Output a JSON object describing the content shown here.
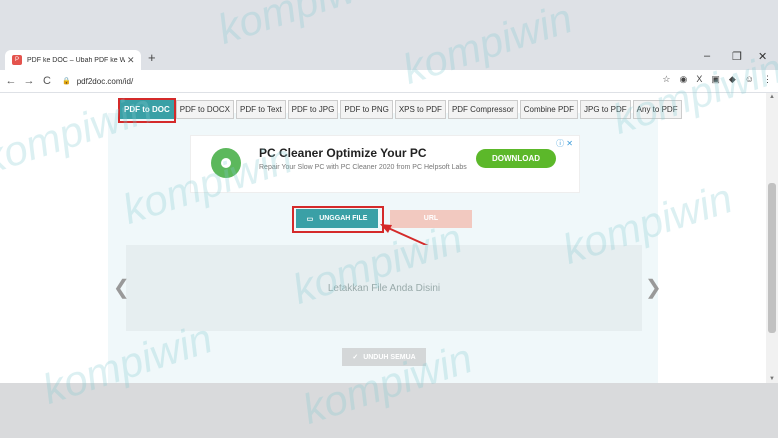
{
  "browser": {
    "tab_title": "PDF ke DOC – Ubah PDF ke Word",
    "new_tab": "+",
    "address": "pdf2doc.com/id/"
  },
  "toolbar": [
    "PDF to DOC",
    "PDF to DOCX",
    "PDF to Text",
    "PDF to JPG",
    "PDF to PNG",
    "XPS to PDF",
    "PDF Compressor",
    "Combine PDF",
    "JPG to PDF",
    "Any to PDF"
  ],
  "ad": {
    "headline": "PC Cleaner Optimize Your PC",
    "description": "Repair Your Slow PC with PC Cleaner 2020 from PC Helpsoft Labs",
    "button": "DOWNLOAD"
  },
  "buttons": {
    "upload": "UNGGAH FILE",
    "download_all": "UNDUH SEMUA"
  },
  "dropzone": "Letakkan File Anda Disini",
  "watermark": "kompiwin",
  "colors": {
    "accent": "#3aa0a6",
    "ad_button": "#5cb82a",
    "highlight": "#d42a2a"
  }
}
